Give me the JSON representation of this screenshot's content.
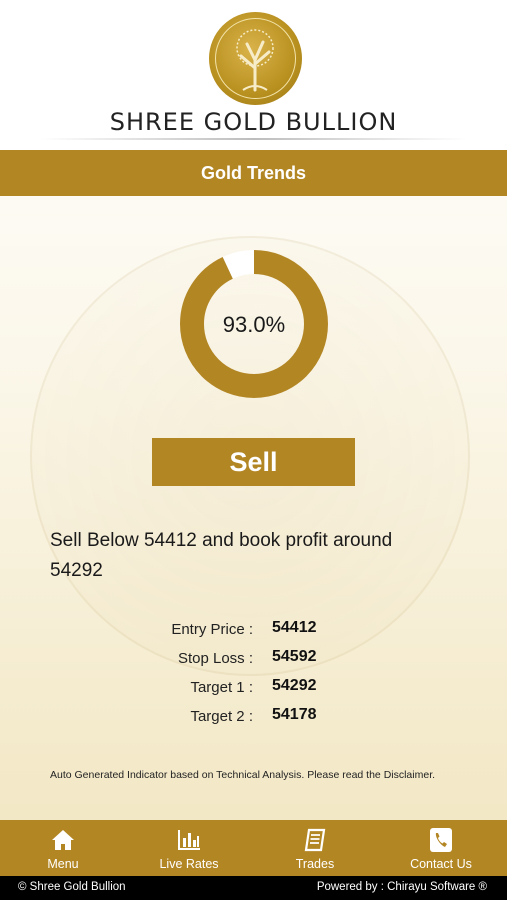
{
  "header": {
    "brand_name": "SHREE GOLD BULLION",
    "logo_icon": "tree-logo-icon"
  },
  "title_bar": {
    "title": "Gold Trends"
  },
  "indicator": {
    "percent_label": "93.0%",
    "percent_value": 93.0,
    "signal_label": "Sell",
    "advice": "Sell Below 54412 and book profit around 54292"
  },
  "levels": [
    {
      "label": "Entry Price :",
      "value": "54412"
    },
    {
      "label": "Stop Loss :",
      "value": "54592"
    },
    {
      "label": "Target 1 :",
      "value": "54292"
    },
    {
      "label": "Target 2 :",
      "value": "54178"
    }
  ],
  "disclaimer": "Auto Generated Indicator based on Technical Analysis. Please read the Disclaimer.",
  "nav": [
    {
      "label": "Menu",
      "icon": "home-icon"
    },
    {
      "label": "Live Rates",
      "icon": "bar-chart-icon"
    },
    {
      "label": "Trades",
      "icon": "book-icon"
    },
    {
      "label": "Contact Us",
      "icon": "phone-icon"
    }
  ],
  "footer": {
    "copyright": "© Shree Gold Bullion",
    "powered_by": "Powered by : Chirayu Software ®"
  },
  "colors": {
    "accent": "#b38624",
    "ring_track": "#ffffff",
    "footer_bg": "#000000"
  }
}
